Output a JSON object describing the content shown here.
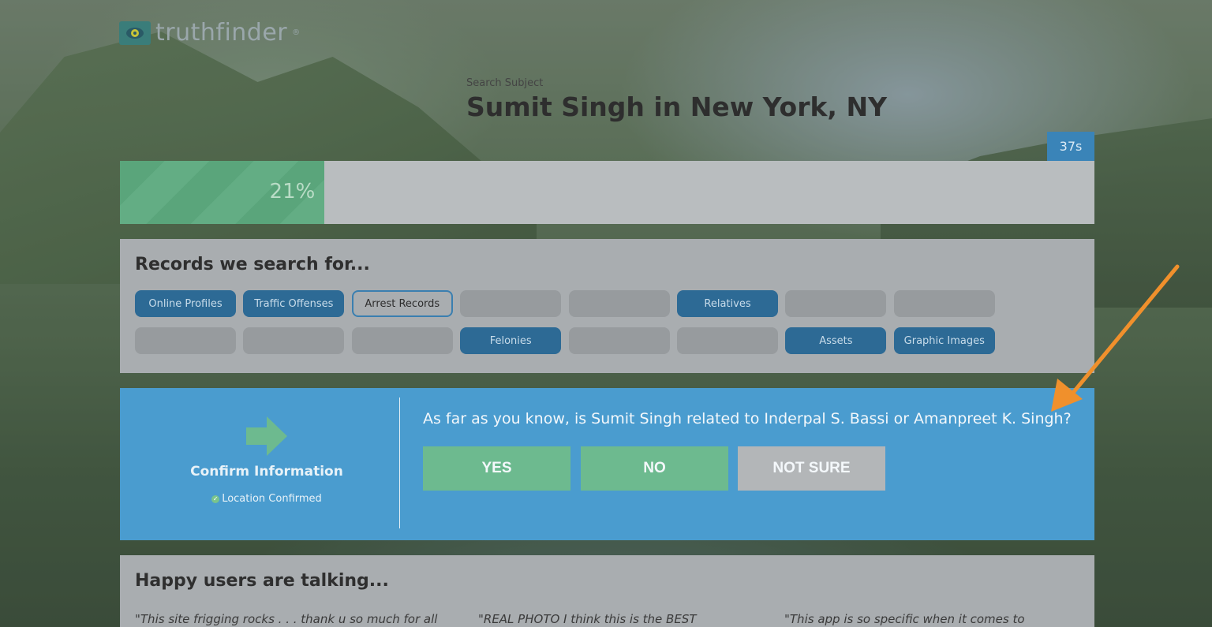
{
  "brand": {
    "name": "truthfinder",
    "reg": "®"
  },
  "subject": {
    "label": "Search Subject",
    "title": "Sumit Singh in New York, NY"
  },
  "timer": "37s",
  "progress": {
    "percent_label": "21%",
    "value": 0.21
  },
  "records": {
    "title": "Records we search for...",
    "chips": [
      {
        "label": "Online Profiles",
        "state": "active"
      },
      {
        "label": "Traffic Offenses",
        "state": "active"
      },
      {
        "label": "Arrest Records",
        "state": "current"
      },
      {
        "label": "",
        "state": "pending"
      },
      {
        "label": "",
        "state": "pending"
      },
      {
        "label": "Relatives",
        "state": "active"
      },
      {
        "label": "",
        "state": "pending"
      },
      {
        "label": "",
        "state": "pending"
      },
      {
        "label": "",
        "state": "pending"
      },
      {
        "label": "",
        "state": "pending"
      },
      {
        "label": "",
        "state": "pending"
      },
      {
        "label": "Felonies",
        "state": "active"
      },
      {
        "label": "",
        "state": "pending"
      },
      {
        "label": "",
        "state": "pending"
      },
      {
        "label": "Assets",
        "state": "active"
      },
      {
        "label": "Graphic Images",
        "state": "active"
      }
    ]
  },
  "confirm": {
    "title": "Confirm Information",
    "location_status": "Location Confirmed",
    "question": "As far as you know, is Sumit Singh related to Inderpal S. Bassi or Amanpreet K. Singh?",
    "yes_label": "YES",
    "no_label": "NO",
    "not_sure_label": "NOT SURE"
  },
  "testimonials": {
    "title": "Happy users are talking...",
    "quotes": [
      "\"This site frigging rocks . . . thank u so much for all",
      "\"REAL PHOTO I think this is the BEST",
      "\"This app is so specific when it comes to"
    ]
  },
  "colors": {
    "accent_blue": "#4a9ccf",
    "active_chip": "#2d6a95",
    "green": "#6dba8f",
    "annotation": "#f0902c"
  }
}
